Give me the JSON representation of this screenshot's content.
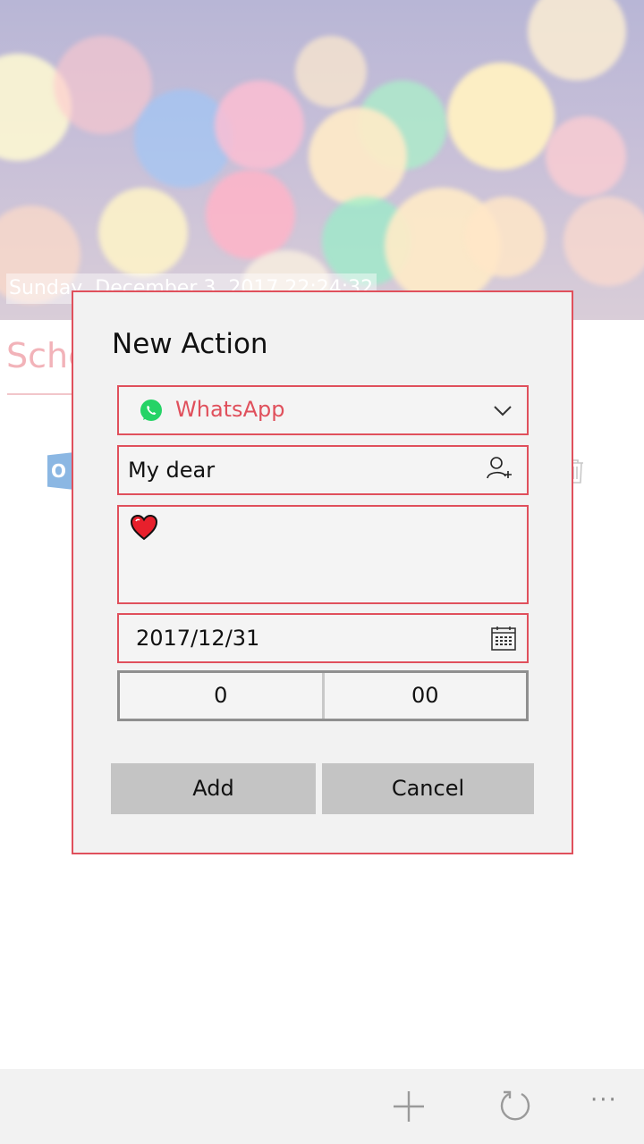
{
  "header": {
    "datetime": "Sunday, December 3, 2017 22:24:32"
  },
  "page": {
    "title": "Schedule",
    "outlook_icon_letter": "O"
  },
  "dialog": {
    "title": "New Action",
    "app_select": {
      "value": "WhatsApp",
      "icon": "whatsapp-icon"
    },
    "contact": {
      "value": "My dear",
      "icon": "add-contact-icon"
    },
    "message": {
      "content_icon": "heart-emoji"
    },
    "date": {
      "value": "2017/12/31",
      "icon": "calendar-icon"
    },
    "time": {
      "hour": "0",
      "minute": "00"
    },
    "buttons": {
      "add": "Add",
      "cancel": "Cancel"
    }
  },
  "appbar": {
    "icons": [
      "add-icon",
      "refresh-icon",
      "more-icon"
    ],
    "more_label": "···"
  },
  "colors": {
    "accent": "#e0505c",
    "whatsapp": "#25d366",
    "button": "#c4c4c4",
    "dialog_bg": "#f2f2f2"
  }
}
